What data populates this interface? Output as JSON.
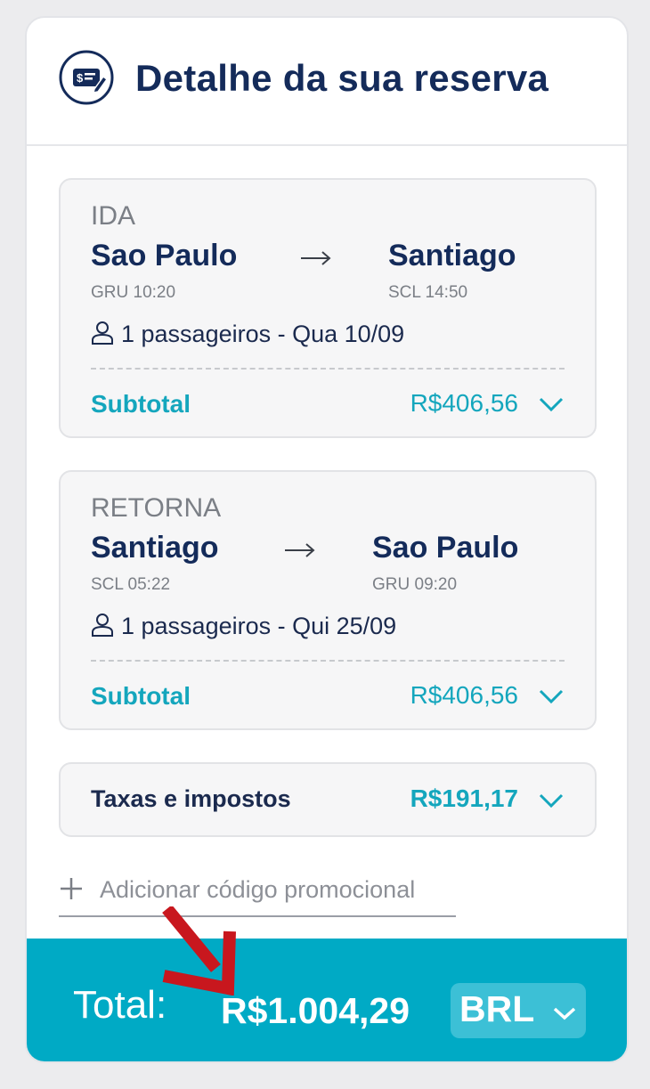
{
  "header": {
    "title": "Detalhe da sua reserva",
    "icon": "ticket-dollar-icon"
  },
  "legs": [
    {
      "label": "IDA",
      "origin_city": "Sao Paulo",
      "origin_code_time": "GRU 10:20",
      "destination_city": "Santiago",
      "destination_code_time": "SCL 14:50",
      "passengers": "1 passageiros - Qua 10/09",
      "subtotal_label": "Subtotal",
      "subtotal_value": "R$406,56"
    },
    {
      "label": "RETORNA",
      "origin_city": "Santiago",
      "origin_code_time": "SCL 05:22",
      "destination_city": "Sao Paulo",
      "destination_code_time": "GRU 09:20",
      "passengers": "1 passageiros - Qui 25/09",
      "subtotal_label": "Subtotal",
      "subtotal_value": "R$406,56"
    }
  ],
  "taxes": {
    "label": "Taxas e impostos",
    "value": "R$191,17"
  },
  "promo": {
    "label": "Adicionar código promocional"
  },
  "footer": {
    "total_label": "Total:",
    "total_value": "R$1.004,29",
    "currency": "BRL"
  },
  "colors": {
    "accent": "#14a6bd",
    "footer_bg": "#00aac5",
    "navy": "#142b5a",
    "annotation_arrow": "#c8171e"
  }
}
